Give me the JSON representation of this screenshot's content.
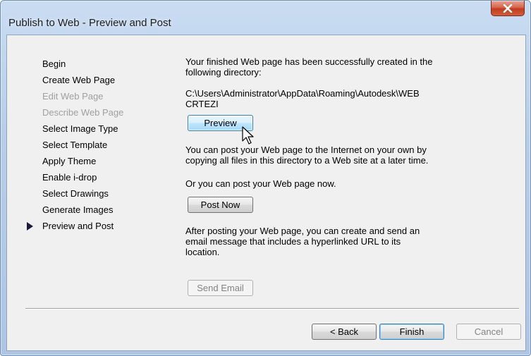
{
  "window": {
    "title": "Publish to Web - Preview and Post"
  },
  "steps": [
    {
      "label": "Begin",
      "enabled": true
    },
    {
      "label": "Create Web Page",
      "enabled": true
    },
    {
      "label": "Edit Web Page",
      "enabled": false
    },
    {
      "label": "Describe Web Page",
      "enabled": false
    },
    {
      "label": "Select Image Type",
      "enabled": true
    },
    {
      "label": "Select Template",
      "enabled": true
    },
    {
      "label": "Apply Theme",
      "enabled": true
    },
    {
      "label": "Enable i-drop",
      "enabled": true
    },
    {
      "label": "Select Drawings",
      "enabled": true
    },
    {
      "label": "Generate Images",
      "enabled": true
    },
    {
      "label": "Preview and Post",
      "enabled": true,
      "current": true
    }
  ],
  "content": {
    "success_line1": "Your finished Web page has been successfully created in the",
    "success_line2": "following directory:",
    "path_line1": "C:\\Users\\Administrator\\AppData\\Roaming\\Autodesk\\WEB",
    "path_line2": "CRTEZI",
    "preview_label": "Preview",
    "post_info_line1": "You can post your Web page to the Internet on your own by",
    "post_info_line2": "copying all files in this directory to a Web site at a later time.",
    "post_now_info": "Or you can post your Web page now.",
    "post_now_label": "Post Now",
    "email_info_line1": "After posting your Web page, you can create and send an",
    "email_info_line2": "email message that includes a hyperlinked URL to its",
    "email_info_line3": "location.",
    "send_email_label": "Send Email"
  },
  "footer": {
    "back_label": "< Back",
    "finish_label": "Finish",
    "cancel_label": "Cancel"
  },
  "icons": {
    "close": "close-icon",
    "current_step": "current-step-arrow-icon",
    "cursor": "mouse-pointer-icon"
  }
}
